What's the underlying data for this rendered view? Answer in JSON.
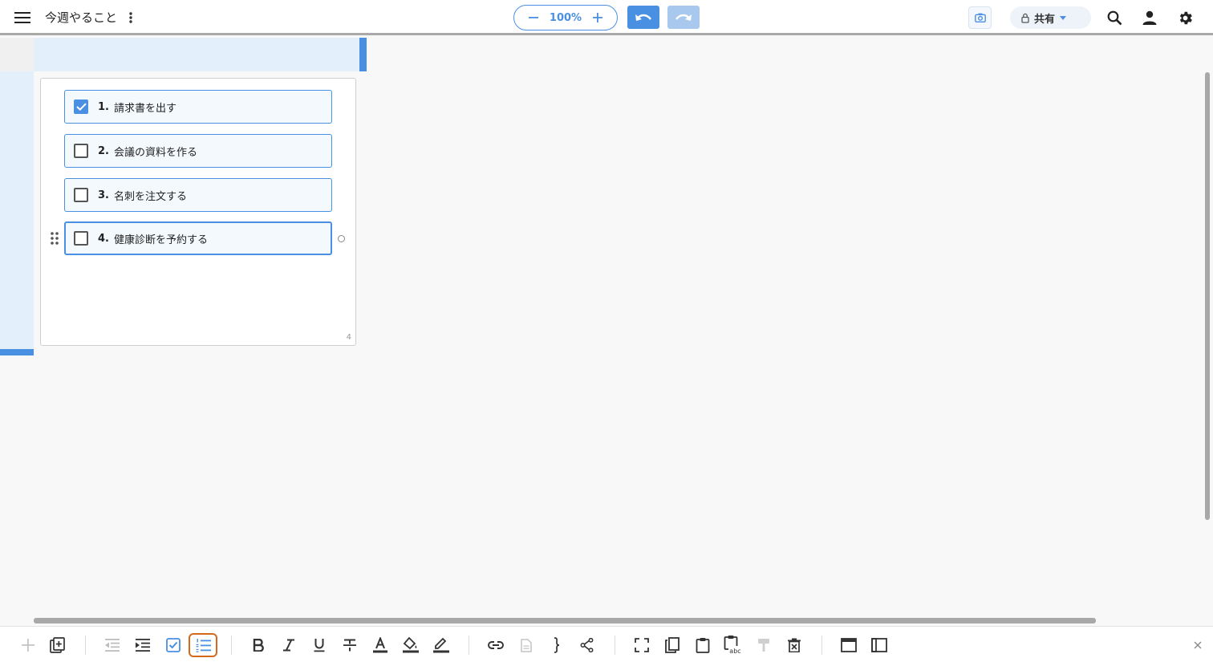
{
  "header": {
    "title": "今週やること",
    "zoom": "100%",
    "share_label": "共有"
  },
  "card": {
    "items": [
      {
        "num": "1.",
        "text": "請求書を出す",
        "checked": true
      },
      {
        "num": "2.",
        "text": "会議の資料を作る",
        "checked": false
      },
      {
        "num": "3.",
        "text": "名刺を注文する",
        "checked": false
      },
      {
        "num": "4.",
        "text": "健康診断を予約する",
        "checked": false
      }
    ],
    "count": "4"
  },
  "toolbar": {
    "selected_tool": "numbered-list",
    "tools": [
      "add-icon",
      "duplicate-icon",
      "outdent-icon",
      "indent-icon",
      "checklist-icon",
      "numbered-list-icon",
      "bold-icon",
      "italic-icon",
      "underline-icon",
      "strikethrough-icon",
      "text-color-icon",
      "fill-color-icon",
      "highlight-icon",
      "link-icon",
      "note-icon",
      "brace-icon",
      "connector-icon",
      "select-frame-icon",
      "copy-icon",
      "paste-icon",
      "paste-text-icon",
      "format-painter-icon",
      "delete-icon",
      "panel-top-icon",
      "panel-left-icon"
    ]
  },
  "colors": {
    "accent": "#4a90e2",
    "accent_light": "#e3f0fc",
    "selected_outline": "#d2691e"
  }
}
